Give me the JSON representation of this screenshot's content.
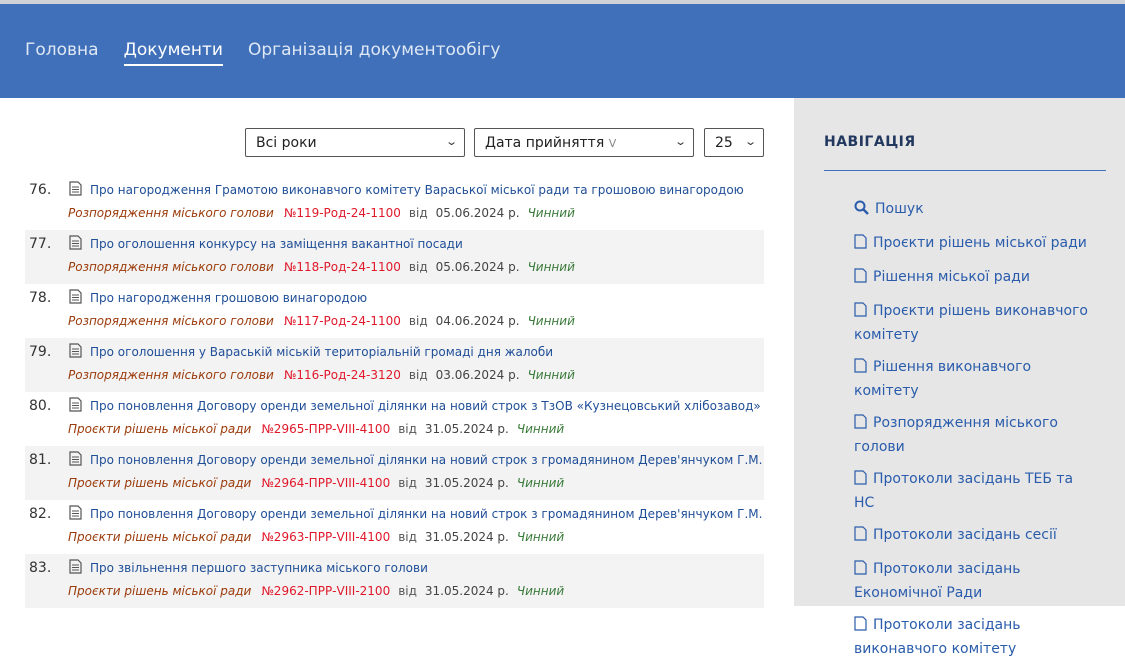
{
  "nav": {
    "items": [
      {
        "label": "Головна",
        "active": false
      },
      {
        "label": "Документи",
        "active": true
      },
      {
        "label": "Організація документообігу",
        "active": false
      }
    ]
  },
  "filters": {
    "year": "Всі роки",
    "sort": "Дата прийняття",
    "sort_indicator": "V",
    "per_page": "25"
  },
  "documents": [
    {
      "num": "76.",
      "title": "Про нагородження Грамотою виконавчого комітету Вараської міської ради та грошовою винагородою",
      "type": "Розпорядження міського голови",
      "code": "№119-Род-24-1100",
      "from": "від",
      "date": "05.06.2024 р.",
      "status": "Чинний"
    },
    {
      "num": "77.",
      "title": "Про оголошення конкурсу на заміщення вакантної посади",
      "type": "Розпорядження міського голови",
      "code": "№118-Род-24-1100",
      "from": "від",
      "date": "05.06.2024 р.",
      "status": "Чинний"
    },
    {
      "num": "78.",
      "title": "Про нагородження грошовою винагородою",
      "type": "Розпорядження міського голови",
      "code": "№117-Род-24-1100",
      "from": "від",
      "date": "04.06.2024 р.",
      "status": "Чинний"
    },
    {
      "num": "79.",
      "title": "Про оголошення у Вараській міській територіальній громаді дня жалоби",
      "type": "Розпорядження міського голови",
      "code": "№116-Род-24-3120",
      "from": "від",
      "date": "03.06.2024 р.",
      "status": "Чинний"
    },
    {
      "num": "80.",
      "title": "Про поновлення Договору оренди земельної ділянки на новий строк з ТзОВ «Кузнецовський хлібозавод»",
      "type": "Проєкти рішень міської ради",
      "code": "№2965-ПРР-VIII-4100",
      "from": "від",
      "date": "31.05.2024 р.",
      "status": "Чинний"
    },
    {
      "num": "81.",
      "title": "Про поновлення Договору оренди земельної ділянки на новий строк з громадянином Дерев'янчуком Г.М.",
      "type": "Проєкти рішень міської ради",
      "code": "№2964-ПРР-VIII-4100",
      "from": "від",
      "date": "31.05.2024 р.",
      "status": "Чинний"
    },
    {
      "num": "82.",
      "title": "Про поновлення Договору оренди земельної ділянки на новий строк з громадянином Дерев'янчуком Г.М.",
      "type": "Проєкти рішень міської ради",
      "code": "№2963-ПРР-VIII-4100",
      "from": "від",
      "date": "31.05.2024 р.",
      "status": "Чинний"
    },
    {
      "num": "83.",
      "title": "Про звільнення першого заступника міського голови",
      "type": "Проєкти рішень міської ради",
      "code": "№2962-ПРР-VIII-2100",
      "from": "від",
      "date": "31.05.2024 р.",
      "status": "Чинний"
    }
  ],
  "sidebar": {
    "title": "НАВІГАЦІЯ",
    "items": [
      {
        "label": "Пошук",
        "icon": "search-icon"
      },
      {
        "label": "Проєкти рішень міської ради",
        "icon": "document-icon"
      },
      {
        "label": "Рішення міської ради",
        "icon": "document-icon"
      },
      {
        "label": "Проєкти рішень виконавчого комітету",
        "icon": "document-icon"
      },
      {
        "label": "Рішення виконавчого комітету",
        "icon": "document-icon"
      },
      {
        "label": "Розпорядження міського голови",
        "icon": "document-icon"
      },
      {
        "label": "Протоколи засідань ТЕБ та НС",
        "icon": "document-icon"
      },
      {
        "label": "Протоколи засідань сесії",
        "icon": "document-icon"
      },
      {
        "label": "Протоколи засідань Економічної Ради",
        "icon": "document-icon"
      },
      {
        "label": "Протоколи засідань виконавчого комітету",
        "icon": "document-icon"
      }
    ]
  },
  "colors": {
    "header": "#3f70b9",
    "link": "#1f4e97",
    "code": "#e0182a",
    "type": "#9b3a0a",
    "status": "#3a7a3a",
    "sidebar_bg": "#e6e6e7"
  }
}
